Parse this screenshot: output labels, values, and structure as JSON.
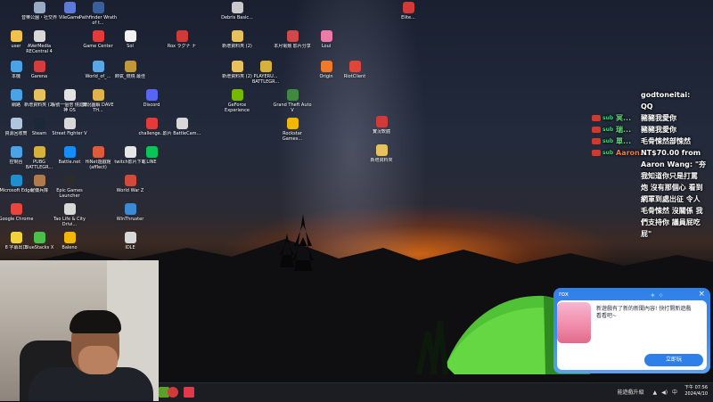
{
  "desktop": {
    "icons": [
      {
        "label": "音樂公園・社交界",
        "color": "#9aa9c4"
      },
      {
        "label": "VileGame",
        "color": "#5c7ad6"
      },
      {
        "label": "Pathfinder Wrath of t...",
        "color": "#3a5f9c"
      },
      {
        "label": "Debris Basic...",
        "color": "#c9c9c9"
      },
      {
        "label": "user",
        "color": "#f0c14b"
      },
      {
        "label": "AVerMedia RECentral 4",
        "color": "#d8d8d8"
      },
      {
        "label": "Game Center",
        "color": "#e63a3a"
      },
      {
        "label": "SoI",
        "color": "#f2f2f2"
      },
      {
        "label": "Rox ラグナ ナ",
        "color": "#d23a3a"
      },
      {
        "label": "新增資料夾 (2)",
        "color": "#e6c15c"
      },
      {
        "label": "本月電競 影片分享",
        "color": "#d04848"
      },
      {
        "label": "Loui",
        "color": "#ee7aa8"
      },
      {
        "label": "本機",
        "color": "#4aa3e6"
      },
      {
        "label": "Garena",
        "color": "#d63c3c"
      },
      {
        "label": "World_of_...",
        "color": "#5aa7e8"
      },
      {
        "label": "帥氣_燃燒 最佳",
        "color": "#c0983a"
      },
      {
        "label": "新增資料夾 (2)",
        "color": "#e6c15c"
      },
      {
        "label": "PLAYERU... BATTLEGR...",
        "color": "#d6b23a"
      },
      {
        "label": "Origin",
        "color": "#f07a2a"
      },
      {
        "label": "RiotClient",
        "color": "#e0453a"
      },
      {
        "label": "網路",
        "color": "#4aa3e6"
      },
      {
        "label": "新增資料夾 (2)",
        "color": "#e6c15c"
      },
      {
        "label": "帳號一個倍 燒進擊神 OS",
        "color": "#e2e2e2"
      },
      {
        "label": "實況圖解 DAVE TH...",
        "color": "#e0b24a"
      },
      {
        "label": "Discord",
        "color": "#5865f2"
      },
      {
        "label": "GeForce Experience",
        "color": "#76b900"
      },
      {
        "label": "Grand Theft Auto V",
        "color": "#3f8a3f"
      },
      {
        "label": "資源回收筒",
        "color": "#b0c6dc"
      },
      {
        "label": "Steam",
        "color": "#1b2838"
      },
      {
        "label": "Street Fighter V",
        "color": "#d8d8d8"
      },
      {
        "label": "challenge...",
        "color": "#e63a3a"
      },
      {
        "label": "影片 BattleCam...",
        "color": "#d8d8d8"
      },
      {
        "label": "Rockstar Games...",
        "color": "#f2b705"
      },
      {
        "label": "控制台",
        "color": "#4aa3e6"
      },
      {
        "label": "PUBG BATTLEGR...",
        "color": "#d6b23a"
      },
      {
        "label": "Battle.net",
        "color": "#148eff"
      },
      {
        "label": "HiNet遊戲館 (afflect)",
        "color": "#e05a3a"
      },
      {
        "label": "twitch影片下載",
        "color": "#e6e6e6"
      },
      {
        "label": "LINE",
        "color": "#06c755"
      },
      {
        "label": "Microsoft Edge",
        "color": "#1e90d0"
      },
      {
        "label": "僱傭兵隊",
        "color": "#b07a4a"
      },
      {
        "label": "Epic Games Launcher",
        "color": "#2c2c2c"
      },
      {
        "label": "World War Z",
        "color": "#d24a3a"
      },
      {
        "label": "Google Chrome",
        "color": "#e8453c"
      },
      {
        "label": "Tao Life & City Drivi...",
        "color": "#d8d8d8"
      },
      {
        "label": "WinThruster",
        "color": "#3a8ad6"
      },
      {
        "label": "8 字幕出口",
        "color": "#f2d23a"
      },
      {
        "label": "BlueStacks X",
        "color": "#4ac04a"
      },
      {
        "label": "Baleno",
        "color": "#f2b705"
      },
      {
        "label": "IDLE",
        "color": "#d8d8d8"
      },
      {
        "label": "Elite...",
        "color": "#d23a3a"
      },
      {
        "label": "實況軟體",
        "color": "#d23a3a"
      },
      {
        "label": "新增資料夾",
        "color": "#e6c15c"
      }
    ]
  },
  "chat": {
    "lines": [
      {
        "type": "name",
        "text": "godtoneitai:"
      },
      {
        "type": "plain",
        "text": "QQ"
      },
      {
        "type": "msg",
        "sub": "sub",
        "name": "冥...",
        "text": "豬豬我愛你",
        "name_color": "#6ad07e"
      },
      {
        "type": "msg",
        "sub": "sub",
        "name": "瑞...",
        "text": "豬豬我愛你",
        "name_color": "#6ad07e"
      },
      {
        "type": "msg",
        "sub": "sub",
        "name": "單...",
        "text": "毛骨悚然部悚然",
        "name_color": "#6ad07e"
      },
      {
        "type": "msg",
        "sub": "sub",
        "name": "Aaron...",
        "text": "NT$70.00 from",
        "name_color": "#f07e3a"
      },
      {
        "type": "plain",
        "text": "Aaron Wang: \"夯夯"
      },
      {
        "type": "plain",
        "text": "我知道你只是打罵"
      },
      {
        "type": "plain",
        "text": "炮 沒有那個心 看到"
      },
      {
        "type": "plain",
        "text": "網軍到處出征 令人"
      },
      {
        "type": "plain",
        "text": "毛骨悚然 沒關係 我"
      },
      {
        "type": "plain",
        "text": "們支持你 議員屁吃"
      },
      {
        "type": "plain",
        "text": "屁\""
      }
    ]
  },
  "taskbar": {
    "tray_text": "能遊戲升級",
    "input_indicator": "中",
    "time": "下午 07:56",
    "date": "2024/4/10"
  },
  "notification": {
    "brand": "rox",
    "close_symbol": "×",
    "message": "新遊戲有了新的新聞內容! 快打開新遊戲看看吧~",
    "button_label": "立即玩"
  }
}
